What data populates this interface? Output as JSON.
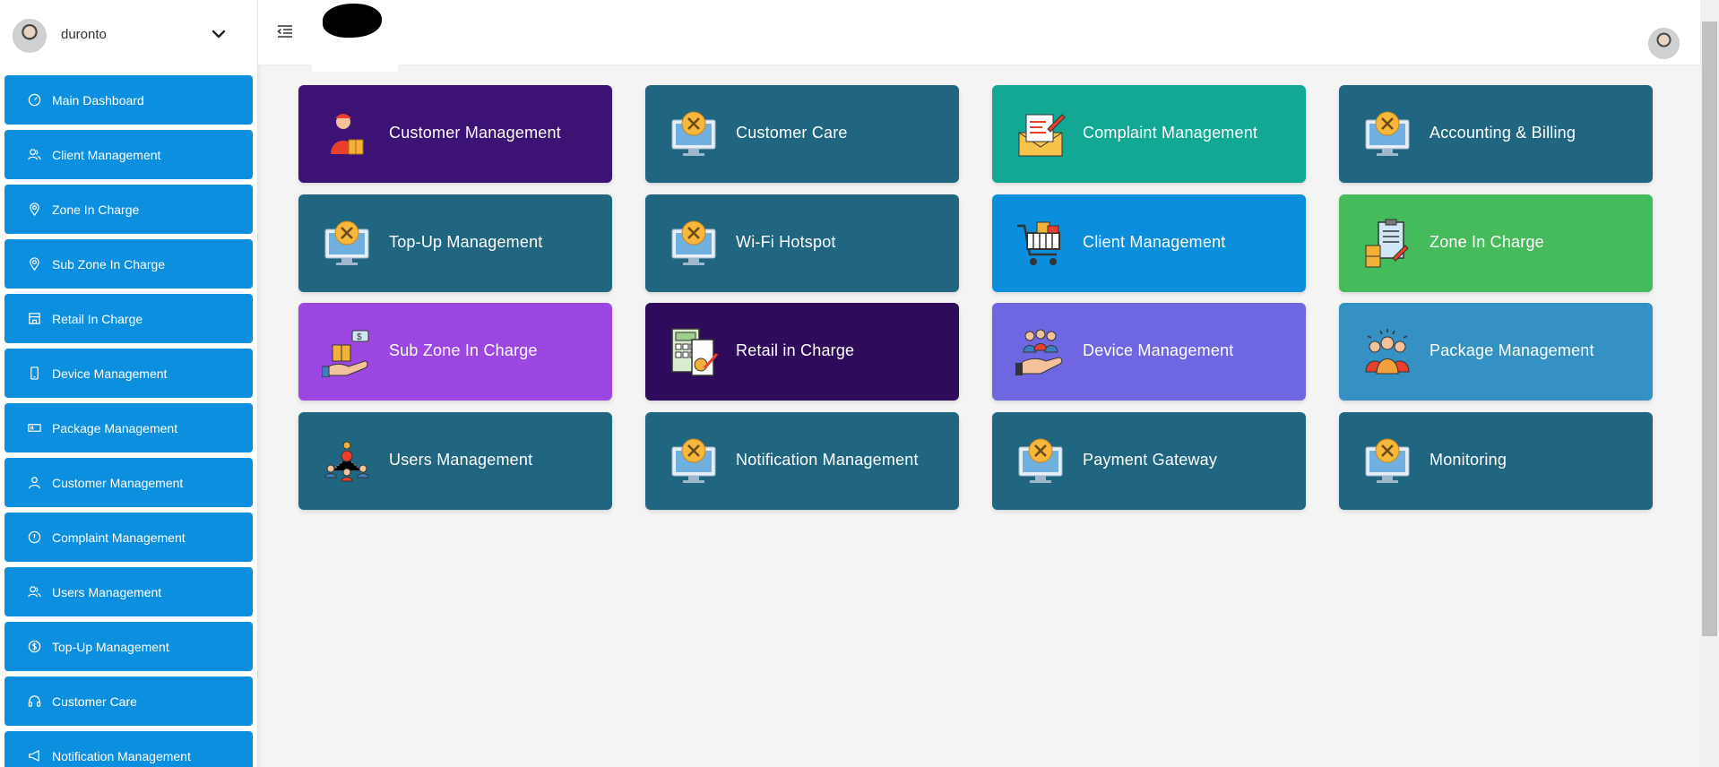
{
  "user": {
    "name": "duronto"
  },
  "sidebar": {
    "items": [
      {
        "label": "Main Dashboard",
        "icon": "dashboard-icon"
      },
      {
        "label": "Client Management",
        "icon": "users-icon"
      },
      {
        "label": "Zone In Charge",
        "icon": "location-pin-icon"
      },
      {
        "label": "Sub Zone In Charge",
        "icon": "location-pin-icon"
      },
      {
        "label": "Retail In Charge",
        "icon": "store-icon"
      },
      {
        "label": "Device Management",
        "icon": "mobile-device-icon"
      },
      {
        "label": "Package Management",
        "icon": "package-icon"
      },
      {
        "label": "Customer Management",
        "icon": "user-icon"
      },
      {
        "label": "Complaint Management",
        "icon": "info-circle-icon"
      },
      {
        "label": "Users Management",
        "icon": "users-icon"
      },
      {
        "label": "Top-Up Management",
        "icon": "dollar-circle-icon"
      },
      {
        "label": "Customer Care",
        "icon": "headset-icon"
      },
      {
        "label": "Notification Management",
        "icon": "megaphone-icon"
      }
    ]
  },
  "cards": [
    {
      "label": "Customer Management",
      "color": "#3c1275",
      "icon": "delivery-person-icon"
    },
    {
      "label": "Customer Care",
      "color": "#216681",
      "icon": "monitor-tools-icon"
    },
    {
      "label": "Complaint Management",
      "color": "#13a894",
      "icon": "envelope-pencil-icon"
    },
    {
      "label": "Accounting & Billing",
      "color": "#216681",
      "icon": "monitor-tools-icon"
    },
    {
      "label": "Top-Up Management",
      "color": "#216681",
      "icon": "monitor-tools-icon"
    },
    {
      "label": "Wi-Fi Hotspot",
      "color": "#216681",
      "icon": "monitor-tools-icon"
    },
    {
      "label": "Client Management",
      "color": "#0b8fdd",
      "icon": "shopping-cart-icon"
    },
    {
      "label": "Zone In Charge",
      "color": "#45bb5b",
      "icon": "clipboard-boxes-icon"
    },
    {
      "label": "Sub Zone In Charge",
      "color": "#9d47e3",
      "icon": "hand-package-icon"
    },
    {
      "label": "Retail in Charge",
      "color": "#2e0c5b",
      "icon": "calculator-invoice-icon"
    },
    {
      "label": "Device Management",
      "color": "#6f66e2",
      "icon": "team-hand-icon"
    },
    {
      "label": "Package Management",
      "color": "#3590c3",
      "icon": "group-people-icon"
    },
    {
      "label": "Users Management",
      "color": "#216681",
      "icon": "network-users-icon"
    },
    {
      "label": "Notification Management",
      "color": "#216681",
      "icon": "monitor-tools-icon"
    },
    {
      "label": "Payment Gateway",
      "color": "#216681",
      "icon": "monitor-tools-icon"
    },
    {
      "label": "Monitoring",
      "color": "#216681",
      "icon": "monitor-tools-icon"
    }
  ]
}
